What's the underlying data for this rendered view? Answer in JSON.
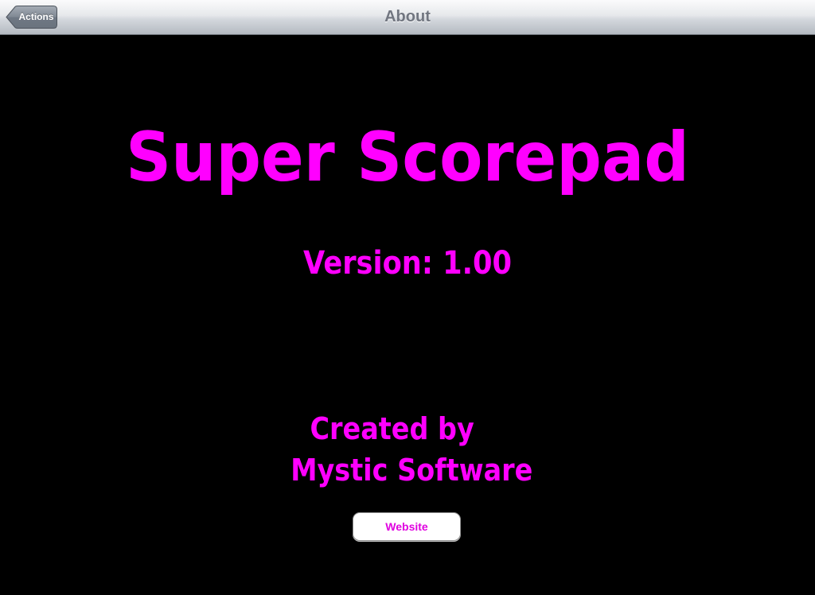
{
  "navbar": {
    "title": "About",
    "back_label": "Actions"
  },
  "about": {
    "app_name": "Super Scorepad",
    "version": "Version: 1.00",
    "created_by_line1": "Created by",
    "created_by_line2": "Mystic Software",
    "website_label": "Website"
  },
  "colors": {
    "background": "#000000",
    "accent_text": "#ff00ff",
    "navbar_title": "#717680"
  }
}
